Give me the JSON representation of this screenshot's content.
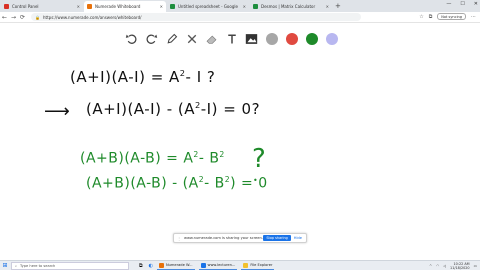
{
  "tabs": [
    {
      "label": "Control Panel",
      "color": "#d93025",
      "active": false
    },
    {
      "label": "Numerade Whiteboard",
      "color": "#e8710a",
      "active": true
    },
    {
      "label": "Untitled spreadsheet - Google",
      "color": "#1e8e3e",
      "active": false
    },
    {
      "label": "Desmos | Matrix Calculator",
      "color": "#1e8e3e",
      "active": false
    }
  ],
  "new_tab": "+",
  "window_controls": {
    "minimize": "—",
    "maximize": "☐",
    "close": "✕"
  },
  "address": {
    "url": "https://www.numerade.com/answers/whiteboard/",
    "sync": "Not syncing"
  },
  "toolbar": {
    "undo_icon": "undo-icon",
    "redo_icon": "redo-icon",
    "colors": {
      "gray": "#a7a7a7",
      "red": "#e04a40",
      "green": "#1e8a2a",
      "purple": "#b8b7f0"
    }
  },
  "whiteboard": {
    "line1": "(A+I)(A-I) = A",
    "line1_sup": "2",
    "line1_end": "- I  ?",
    "arrow": "⟶",
    "line2": "(A+I)(A-I) - (A",
    "line2_sup": "2",
    "line2_end": "-I) = 0?",
    "line3": "(A+B)(A-B) = A",
    "line3_sup": "2",
    "line3_mid": "- B",
    "line3_sup2": "2",
    "line4": "(A+B)(A-B) - (A",
    "line4_sup": "2",
    "line4_mid": "- B",
    "line4_sup2": "2",
    "line4_end": ") = 0",
    "question": "?",
    "dot": "•"
  },
  "share": {
    "text": "www.numerade.com is sharing your screen.",
    "stop": "Stop sharing",
    "hide": "Hide"
  },
  "taskbar": {
    "search": "Type here to search",
    "apps": [
      {
        "label": "Numerade W...",
        "color": "#e8710a"
      },
      {
        "label": "www.lecturen...",
        "color": "#1a73e8"
      },
      {
        "label": "File Explorer",
        "color": "#f2c12e"
      }
    ],
    "time": "10:22 AM",
    "date": "11/18/2020"
  }
}
